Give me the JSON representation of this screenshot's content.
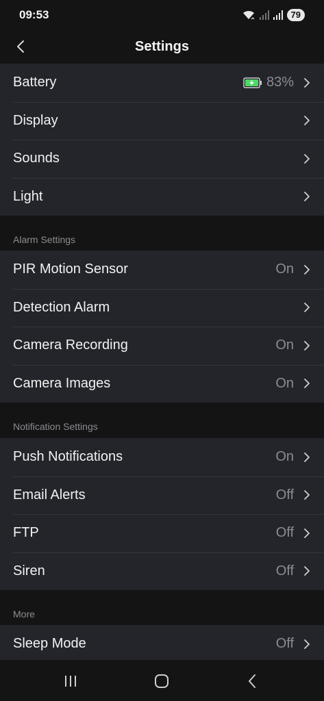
{
  "status_bar": {
    "time": "09:53",
    "battery_level": "79",
    "icons": [
      "wifi-icon",
      "signal-icon",
      "signal-r-icon"
    ]
  },
  "header": {
    "title": "Settings",
    "back_icon": "chevron-left-icon"
  },
  "device_group": {
    "items": [
      {
        "label": "Battery",
        "value": "83%",
        "battery_color": "#4cd964"
      },
      {
        "label": "Display",
        "value": ""
      },
      {
        "label": "Sounds",
        "value": ""
      },
      {
        "label": "Light",
        "value": ""
      }
    ]
  },
  "alarm_section": {
    "title": "Alarm Settings",
    "items": [
      {
        "label": "PIR Motion Sensor",
        "value": "On"
      },
      {
        "label": "Detection Alarm",
        "value": ""
      },
      {
        "label": "Camera Recording",
        "value": "On"
      },
      {
        "label": "Camera Images",
        "value": "On"
      }
    ]
  },
  "notification_section": {
    "title": "Notification Settings",
    "items": [
      {
        "label": "Push Notifications",
        "value": "On"
      },
      {
        "label": "Email Alerts",
        "value": "Off"
      },
      {
        "label": "FTP",
        "value": "Off"
      },
      {
        "label": "Siren",
        "value": "Off"
      }
    ]
  },
  "more_section": {
    "title": "More",
    "items": [
      {
        "label": "Sleep Mode",
        "value": "Off"
      }
    ]
  },
  "nav_bar": {
    "icons": [
      "recent-apps-icon",
      "home-icon",
      "back-icon"
    ]
  },
  "colors": {
    "background": "#141414",
    "row_background": "#23252b",
    "value_text": "#8b8d92",
    "accent_battery": "#4cd964"
  }
}
